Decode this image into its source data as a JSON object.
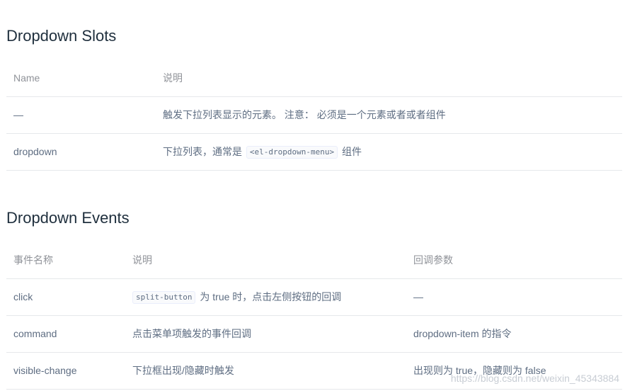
{
  "slots": {
    "title": "Dropdown Slots",
    "headers": {
      "name": "Name",
      "desc": "说明"
    },
    "rows": [
      {
        "name": "—",
        "desc": "触发下拉列表显示的元素。 注意： 必须是一个元素或者或者组件"
      },
      {
        "name": "dropdown",
        "desc_pre": "下拉列表，通常是",
        "desc_code": "<el-dropdown-menu>",
        "desc_post": "组件"
      }
    ]
  },
  "events": {
    "title": "Dropdown Events",
    "headers": {
      "name": "事件名称",
      "desc": "说明",
      "params": "回调参数"
    },
    "rows": [
      {
        "name": "click",
        "desc_code": "split-button",
        "desc_post": "为 true 时，点击左侧按钮的回调",
        "params": "—"
      },
      {
        "name": "command",
        "desc": "点击菜单项触发的事件回调",
        "params": "dropdown-item 的指令"
      },
      {
        "name": "visible-change",
        "desc": "下拉框出现/隐藏时触发",
        "params": "出现则为 true，隐藏则为 false"
      }
    ]
  },
  "watermark": "https://blog.csdn.net/weixin_45343884"
}
